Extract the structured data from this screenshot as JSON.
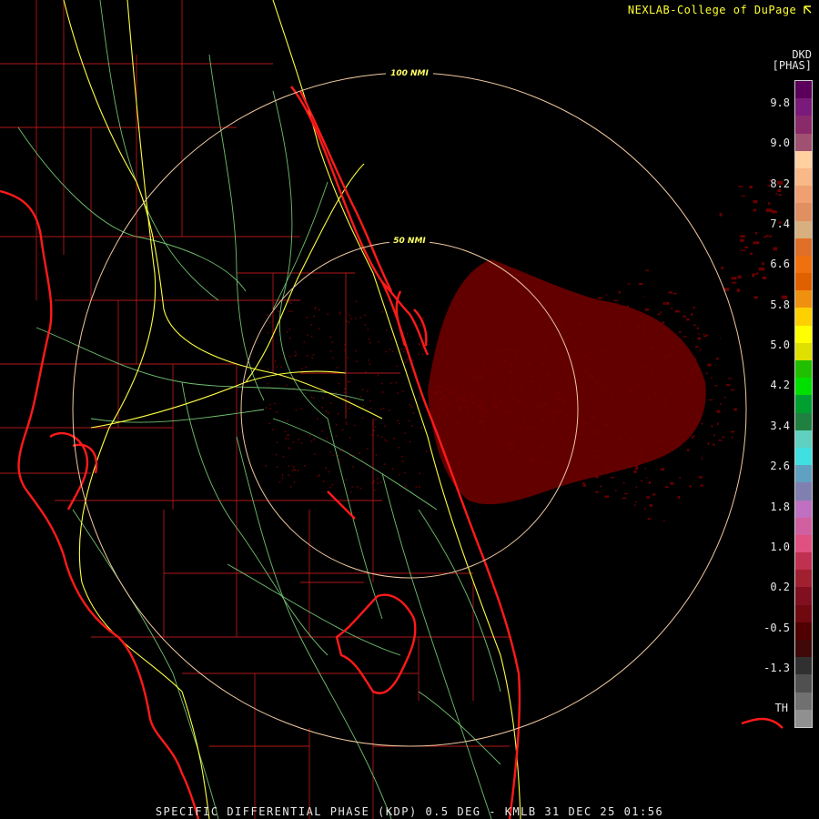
{
  "credit": "NEXLAB-College of DuPage",
  "credit_icon": "cursor-arrow-icon",
  "legend": {
    "product_code": "DKD",
    "unit": "[PHAS]",
    "tick_labels": [
      "9.8",
      "9.0",
      "8.2",
      "7.4",
      "6.6",
      "5.8",
      "5.0",
      "4.2",
      "3.4",
      "2.6",
      "1.8",
      "1.0",
      "0.2",
      "-0.5",
      "-1.3"
    ],
    "threshold_label": "TH",
    "colors": [
      "#5a005a",
      "#7a1a7a",
      "#8a2a6a",
      "#a05070",
      "#ffd0a0",
      "#f8b888",
      "#f0a070",
      "#e09060",
      "#d8b080",
      "#e07028",
      "#f07010",
      "#e06000",
      "#f09010",
      "#ffd000",
      "#ffff00",
      "#e0e000",
      "#20c000",
      "#00e000",
      "#00a030",
      "#208040",
      "#60d0c0",
      "#40e0e0",
      "#60a0c0",
      "#8080b0",
      "#c070c0",
      "#d060a0",
      "#e05080",
      "#c03050",
      "#a02030",
      "#801020",
      "#700810",
      "#500000",
      "#400808",
      "#303030",
      "#505050",
      "#707070",
      "#909090"
    ]
  },
  "rings": {
    "inner_label": "50 NMI",
    "outer_label": "100 NMI",
    "color": "#f0c8a0"
  },
  "map_colors": {
    "coast": "#ff1a1a",
    "county": "#b01818",
    "highway": "#ffff40",
    "road": "#70c070",
    "echo": "#6a0000"
  },
  "caption": "SPECIFIC DIFFERENTIAL PHASE (KDP) 0.5 DEG - KMLB 31 DEC 25 01:56"
}
